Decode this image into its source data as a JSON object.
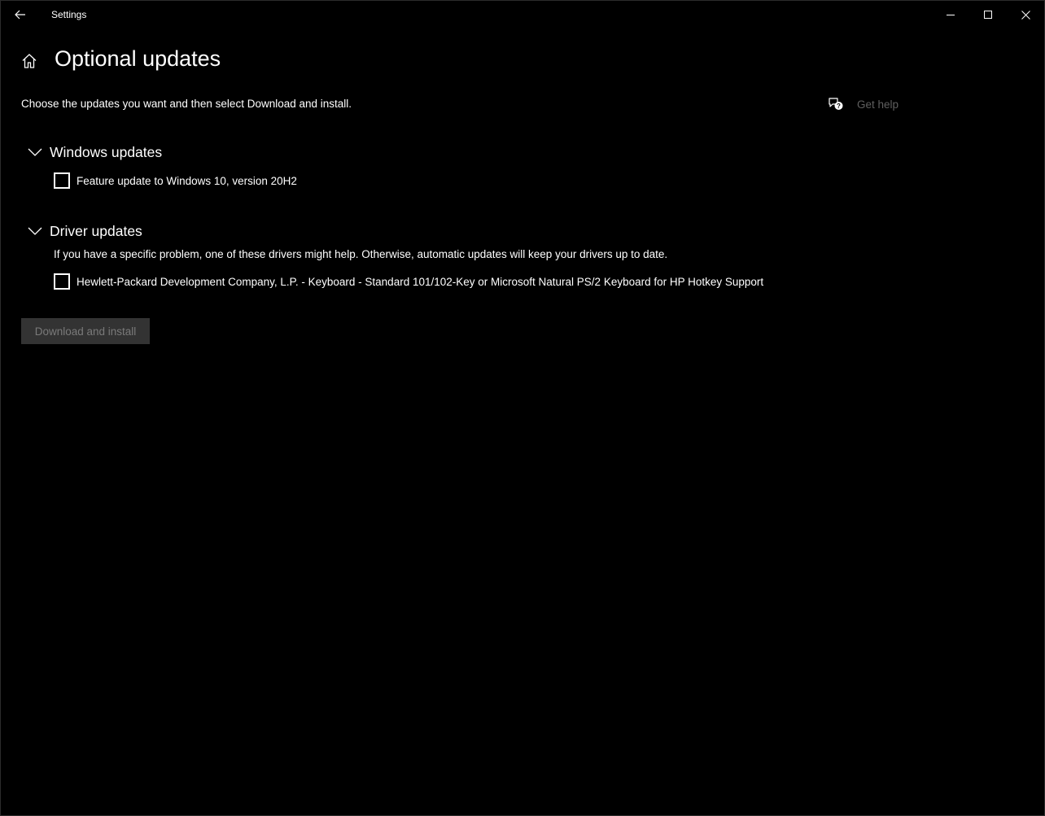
{
  "window": {
    "app_title": "Settings",
    "controls": {
      "minimize_icon": "minimize-icon",
      "maximize_icon": "maximize-icon",
      "close_icon": "close-icon"
    },
    "back_icon": "back-arrow-icon"
  },
  "header": {
    "home_icon": "home-icon",
    "title": "Optional updates",
    "intro": "Choose the updates you want and then select Download and install."
  },
  "help": {
    "icon": "chat-help-icon",
    "label": "Get help"
  },
  "sections": {
    "windows": {
      "title": "Windows updates",
      "expanded": true,
      "items": [
        {
          "label": "Feature update to Windows 10, version 20H2",
          "checked": false
        }
      ]
    },
    "driver": {
      "title": "Driver updates",
      "expanded": true,
      "description": "If you have a specific problem, one of these drivers might help. Otherwise, automatic updates will keep your drivers up to date.",
      "items": [
        {
          "label": "Hewlett-Packard Development Company, L.P. - Keyboard - Standard 101/102-Key or Microsoft Natural PS/2 Keyboard for HP Hotkey Support",
          "checked": false
        }
      ]
    }
  },
  "actions": {
    "download_label": "Download and install",
    "download_enabled": false
  },
  "colors": {
    "background": "#000000",
    "text": "#ffffff",
    "disabled_text": "#7a7a7a",
    "disabled_button": "#333333",
    "help_text": "#5f5f5f"
  }
}
